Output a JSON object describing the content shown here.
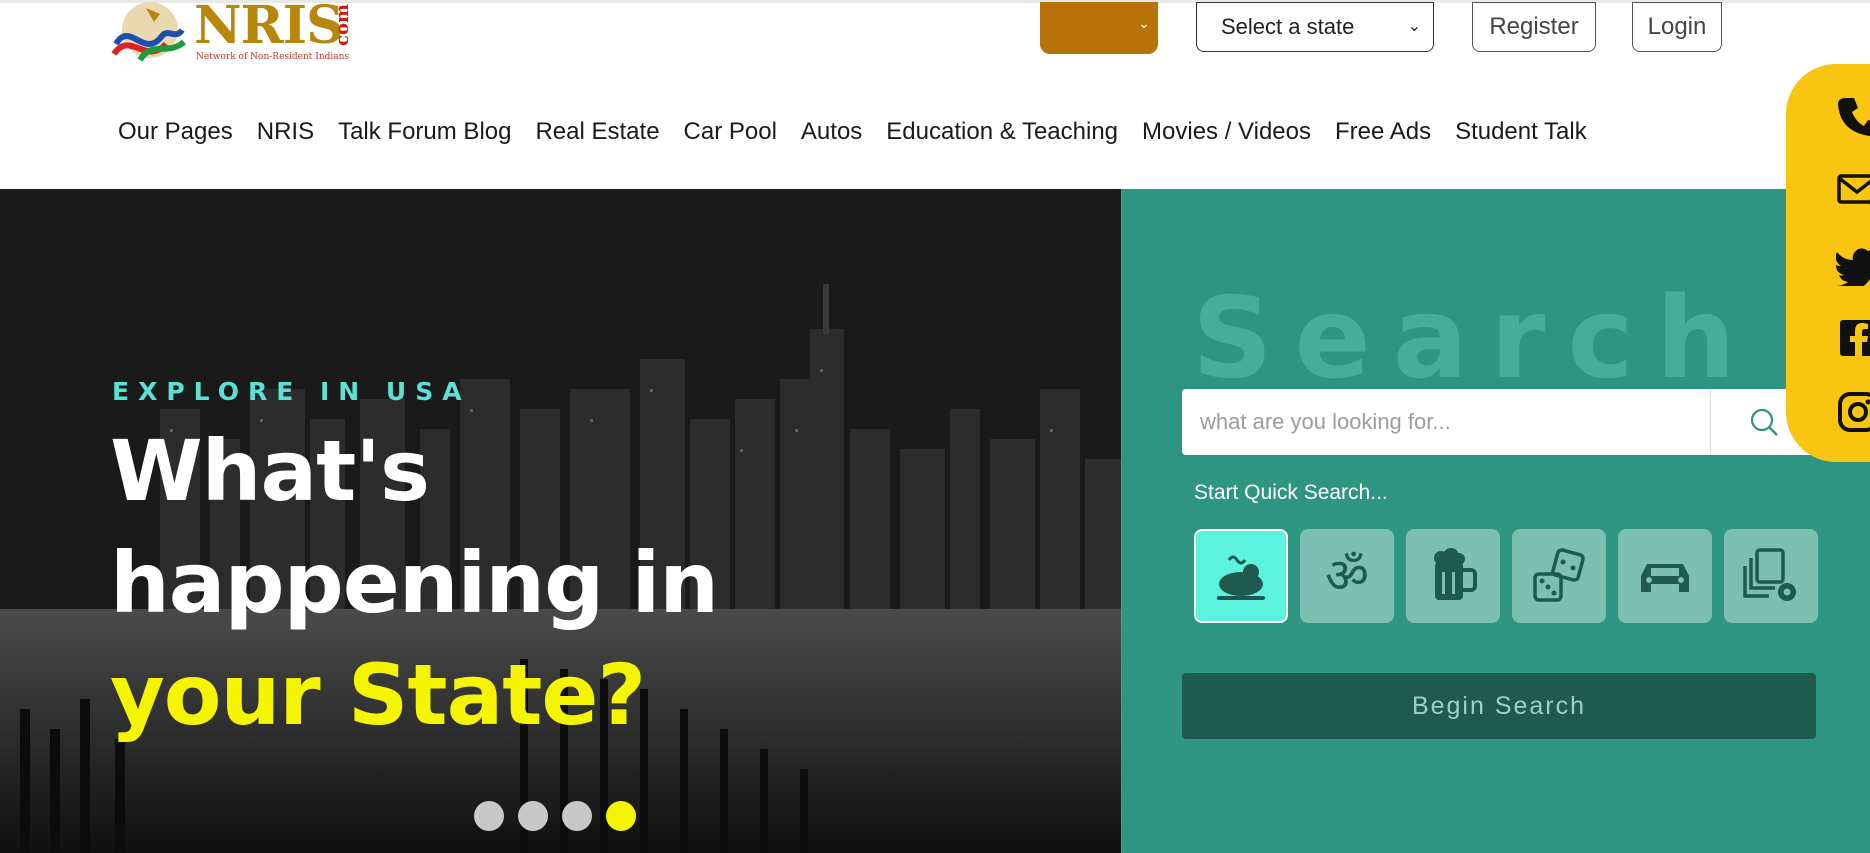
{
  "header": {
    "logo_text": "NRIS",
    "logo_suffix": "com",
    "logo_tagline": "Network of Non-Resident Indians",
    "state_select": {
      "selected": "Select a state"
    },
    "register_label": "Register",
    "login_label": "Login"
  },
  "nav": [
    "Our Pages",
    "NRIS",
    "Talk Forum Blog",
    "Real Estate",
    "Car Pool",
    "Autos",
    "Education & Teaching",
    "Movies / Videos",
    "Free Ads",
    "Student Talk"
  ],
  "social": [
    "phone-icon",
    "mail-icon",
    "twitter-icon",
    "facebook-icon",
    "instagram-icon"
  ],
  "hero": {
    "eyebrow": "EXPLORE IN USA",
    "headline_line1": "What's",
    "headline_line2": "happening in",
    "headline_line3": "your State?",
    "slides_total": 4,
    "active_slide": 4
  },
  "search": {
    "watermark": "Search",
    "placeholder": "what are you looking for...",
    "quick_label": "Start Quick Search...",
    "quick_icons": [
      "food-icon",
      "om-icon",
      "beer-icon",
      "dice-icon",
      "car-icon",
      "files-settings-icon"
    ],
    "begin_label": "Begin Search"
  },
  "colors": {
    "lang_button": "#b8730a",
    "social_bar": "#f8c510",
    "panel": "#2f9583",
    "accent_yellow": "#f5f500",
    "eyebrow": "#5ce0d5",
    "begin_button": "#1e5a4f"
  }
}
